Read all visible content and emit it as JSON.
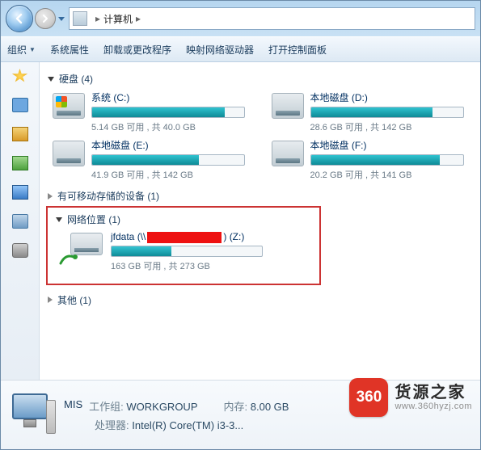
{
  "address": {
    "root": "计算机"
  },
  "toolbar": {
    "organize": "组织",
    "properties": "系统属性",
    "uninstall": "卸载或更改程序",
    "mapdrive": "映射网络驱动器",
    "controlpanel": "打开控制面板"
  },
  "sections": {
    "hdd_label": "硬盘 (4)",
    "removable_label": "有可移动存储的设备 (1)",
    "netloc_label": "网络位置 (1)",
    "other_label": "其他 (1)"
  },
  "drives": {
    "c": {
      "title": "系统 (C:)",
      "usage": "5.14 GB 可用 , 共 40.0 GB",
      "fill": "87%"
    },
    "d": {
      "title": "本地磁盘 (D:)",
      "usage": "28.6 GB 可用 , 共 142 GB",
      "fill": "80%"
    },
    "e": {
      "title": "本地磁盘 (E:)",
      "usage": "41.9 GB 可用 , 共 142 GB",
      "fill": "70%"
    },
    "f": {
      "title": "本地磁盘 (F:)",
      "usage": "20.2 GB 可用 , 共 141 GB",
      "fill": "85%"
    }
  },
  "netdrive": {
    "title_prefix": "jfdata (\\\\",
    "title_suffix": ") (Z:)",
    "usage": "163 GB 可用 , 共 273 GB",
    "fill": "40%"
  },
  "details": {
    "name": "MIS",
    "workgroup_label": "工作组:",
    "workgroup": "WORKGROUP",
    "cpu_label": "处理器:",
    "cpu": "Intel(R) Core(TM) i3-3...",
    "mem_label": "内存:",
    "mem": "8.00 GB"
  },
  "brand": {
    "badge": "360",
    "title": "货源之家",
    "url": "www.360hyzj.com"
  }
}
